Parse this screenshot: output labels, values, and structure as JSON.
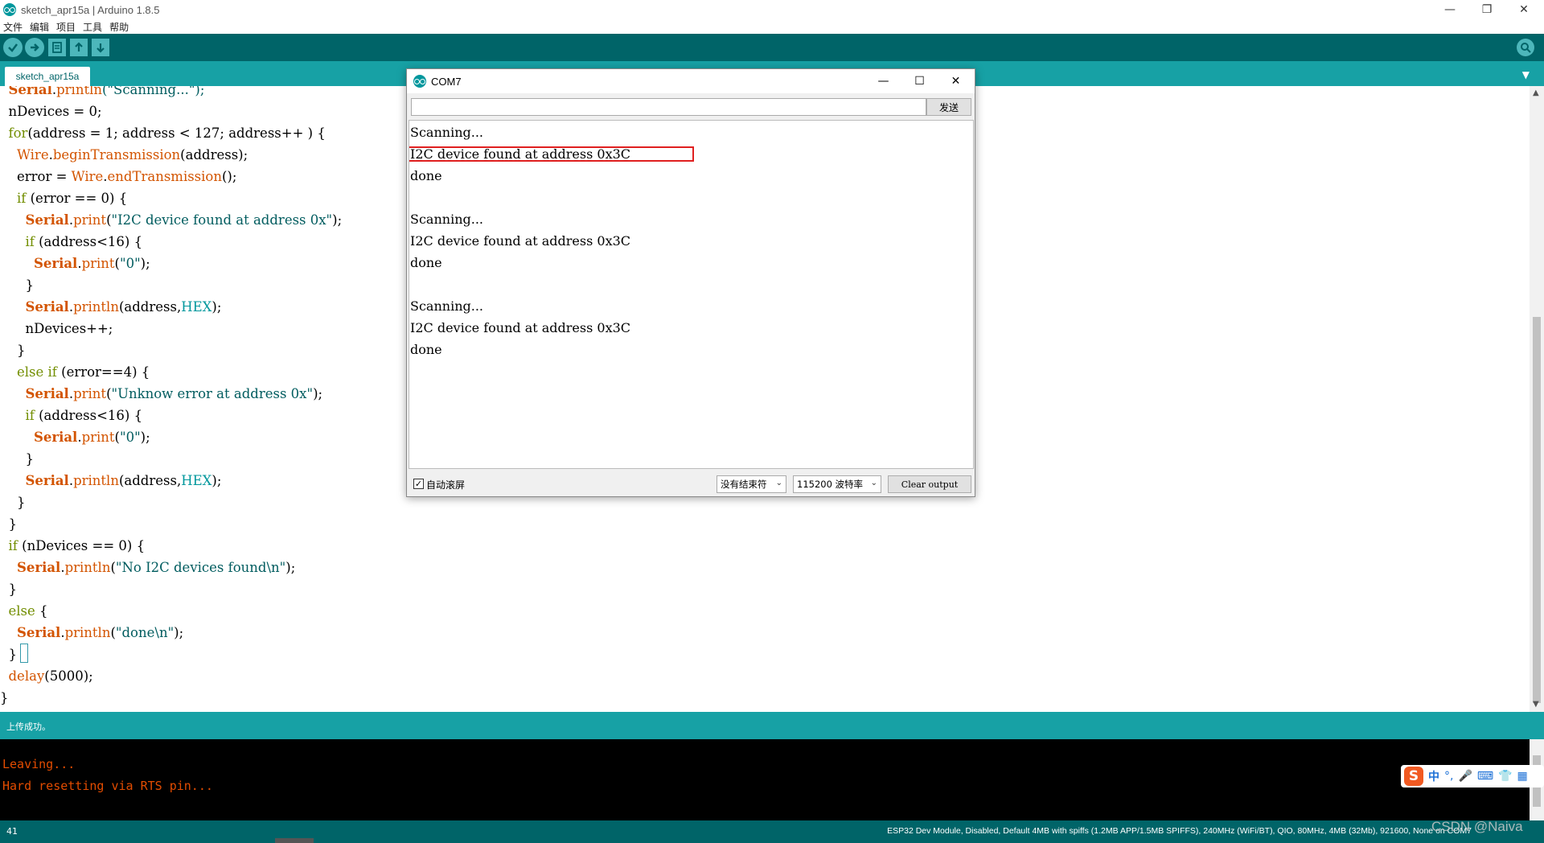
{
  "window": {
    "title": "sketch_apr15a | Arduino 1.8.5",
    "minimize": "—",
    "restore": "❐",
    "close": "✕"
  },
  "menu": [
    "文件",
    "编辑",
    "项目",
    "工具",
    "帮助"
  ],
  "toolbar": {
    "verify": "✓",
    "upload": "→",
    "new": "▤",
    "open": "↑",
    "save": "↓",
    "serial_monitor": "⌕"
  },
  "tab": {
    "name": "sketch_apr15a",
    "menu": "▼"
  },
  "code": {
    "l0": [
      "  ",
      "Serial",
      ".",
      "println",
      "(\"Scanning...\");"
    ],
    "l1": "  nDevices = 0;",
    "l2": [
      "  ",
      "for",
      "(address = 1; address < 127; address++ ) {"
    ],
    "l3": [
      "    ",
      "Wire",
      ".",
      "beginTransmission",
      "(address);"
    ],
    "l4": [
      "    error = ",
      "Wire",
      ".",
      "endTransmission",
      "();"
    ],
    "l5": [
      "    ",
      "if",
      " (error == 0) {"
    ],
    "l6": [
      "      ",
      "Serial",
      ".",
      "print",
      "(",
      "\"I2C device found at address 0x\"",
      ");"
    ],
    "l7": [
      "      ",
      "if",
      " (address<16) {"
    ],
    "l8": [
      "        ",
      "Serial",
      ".",
      "print",
      "(",
      "\"0\"",
      ");"
    ],
    "l9": "      }",
    "l10": [
      "      ",
      "Serial",
      ".",
      "println",
      "(address,",
      "HEX",
      ");"
    ],
    "l11": "      nDevices++;",
    "l12": "    }",
    "l13": [
      "    ",
      "else if",
      " (error==4) {"
    ],
    "l14": [
      "      ",
      "Serial",
      ".",
      "print",
      "(",
      "\"Unknow error at address 0x\"",
      ");"
    ],
    "l15": [
      "      ",
      "if",
      " (address<16) {"
    ],
    "l16": [
      "        ",
      "Serial",
      ".",
      "print",
      "(",
      "\"0\"",
      ");"
    ],
    "l17": "      }",
    "l18": [
      "      ",
      "Serial",
      ".",
      "println",
      "(address,",
      "HEX",
      ");"
    ],
    "l19": "    }",
    "l20": "  }",
    "l21": [
      "  ",
      "if",
      " (nDevices == 0) {"
    ],
    "l22": [
      "    ",
      "Serial",
      ".",
      "println",
      "(",
      "\"No I2C devices found\\n\"",
      ");"
    ],
    "l23": "  }",
    "l24": [
      "  ",
      "else",
      " {"
    ],
    "l25": [
      "    ",
      "Serial",
      ".",
      "println",
      "(",
      "\"done\\n\"",
      ");"
    ],
    "l26": "  }",
    "l27": [
      "  ",
      "delay",
      "(5000);"
    ],
    "l28": "}"
  },
  "status": {
    "message": "上传成功。"
  },
  "console": {
    "lines": [
      "Leaving...",
      "Hard resetting via RTS pin..."
    ]
  },
  "bottom": {
    "line_number": "41",
    "board_info": "ESP32 Dev Module, Disabled, Default 4MB with spiffs (1.2MB APP/1.5MB SPIFFS), 240MHz (WiFi/BT), QIO, 80MHz, 4MB (32Mb), 921600, None on COM7"
  },
  "ime": {
    "logo": "S",
    "mode": "中",
    "punct": "°,",
    "mic": "🎤",
    "keyboard": "⌨",
    "skin": "👕",
    "grid": "▦"
  },
  "watermark": "CSDN @Naiva",
  "serial_monitor": {
    "title": "COM7",
    "minimize": "—",
    "maximize": "☐",
    "close": "✕",
    "input_value": "",
    "send_label": "发送",
    "output": [
      "Scanning...",
      "I2C device found at address 0x3C",
      "done",
      "",
      "Scanning...",
      "I2C device found at address 0x3C",
      "done",
      "",
      "Scanning...",
      "I2C device found at address 0x3C",
      "done"
    ],
    "autoscroll_label": "自动滚屏",
    "autoscroll_checked": "✓",
    "line_ending": "没有结束符",
    "baud_rate": "115200 波特率",
    "clear_label": "Clear output"
  }
}
